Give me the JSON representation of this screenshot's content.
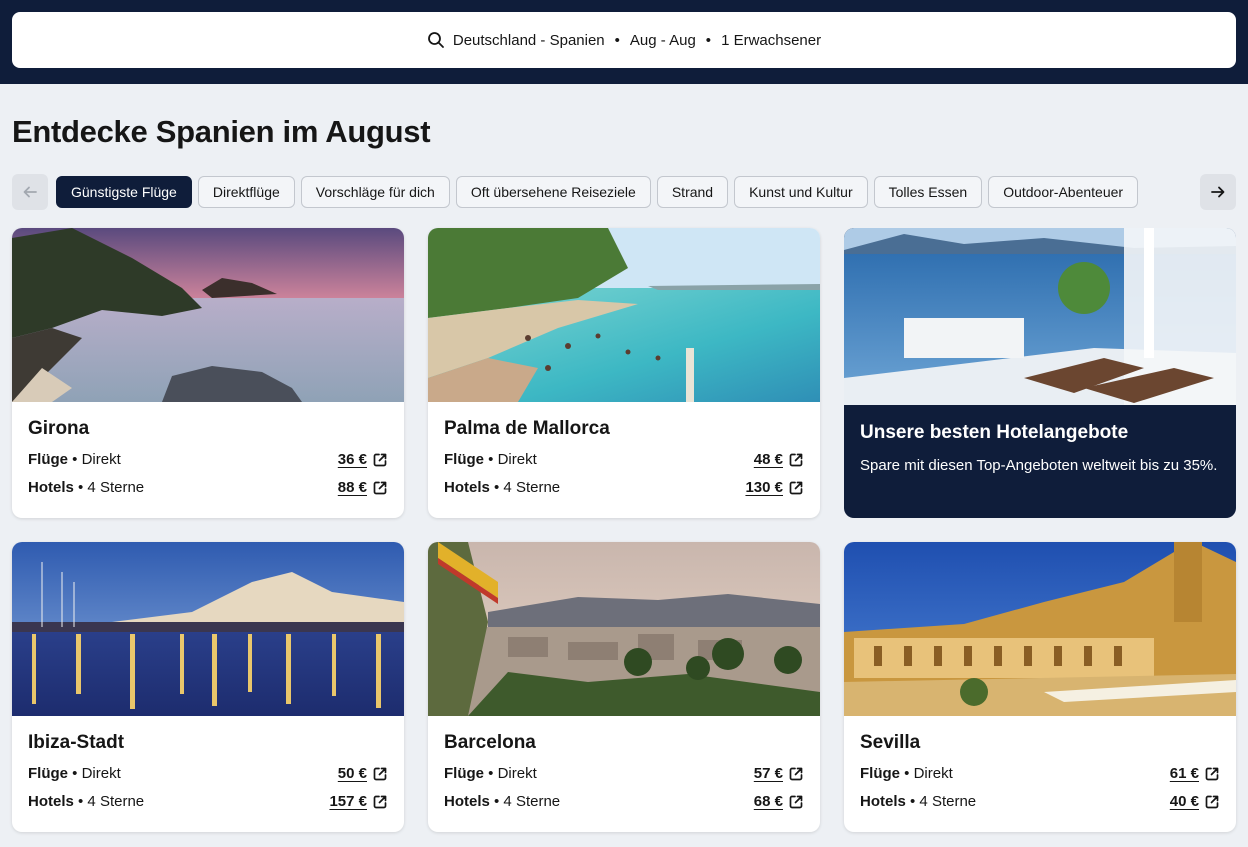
{
  "search": {
    "route": "Deutschland - Spanien",
    "dates": "Aug - Aug",
    "travelers": "1 Erwachsener",
    "separator": "•"
  },
  "page_title": "Entdecke Spanien im August",
  "filters": [
    {
      "label": "Günstigste Flüge",
      "active": true
    },
    {
      "label": "Direktflüge",
      "active": false
    },
    {
      "label": "Vorschläge für dich",
      "active": false
    },
    {
      "label": "Oft übersehene Reiseziele",
      "active": false
    },
    {
      "label": "Strand",
      "active": false
    },
    {
      "label": "Kunst und Kultur",
      "active": false
    },
    {
      "label": "Tolles Essen",
      "active": false
    },
    {
      "label": "Outdoor-Abenteuer",
      "active": false
    }
  ],
  "labels": {
    "flights": "Flüge",
    "flights_detail": " • Direkt",
    "hotels": "Hotels",
    "hotels_detail": " • 4 Sterne"
  },
  "destinations": [
    {
      "name": "Girona",
      "flight_price": "36 €",
      "hotel_price": "88 €"
    },
    {
      "name": "Palma de Mallorca",
      "flight_price": "48 €",
      "hotel_price": "130 €"
    },
    {
      "name": "Ibiza-Stadt",
      "flight_price": "50 €",
      "hotel_price": "157 €"
    },
    {
      "name": "Barcelona",
      "flight_price": "57 €",
      "hotel_price": "68 €"
    },
    {
      "name": "Sevilla",
      "flight_price": "61 €",
      "hotel_price": "40 €"
    }
  ],
  "promo": {
    "title": "Unsere besten Hotelangebote",
    "text": "Spare mit diesen Top-Angeboten weltweit bis zu 35%."
  },
  "colors": {
    "navy": "#0f1d3a",
    "background": "#edf0f4",
    "card": "#ffffff"
  },
  "icons": {
    "search": "search-icon",
    "external": "external-link-icon",
    "prev": "arrow-left-icon",
    "next": "arrow-right-icon"
  }
}
